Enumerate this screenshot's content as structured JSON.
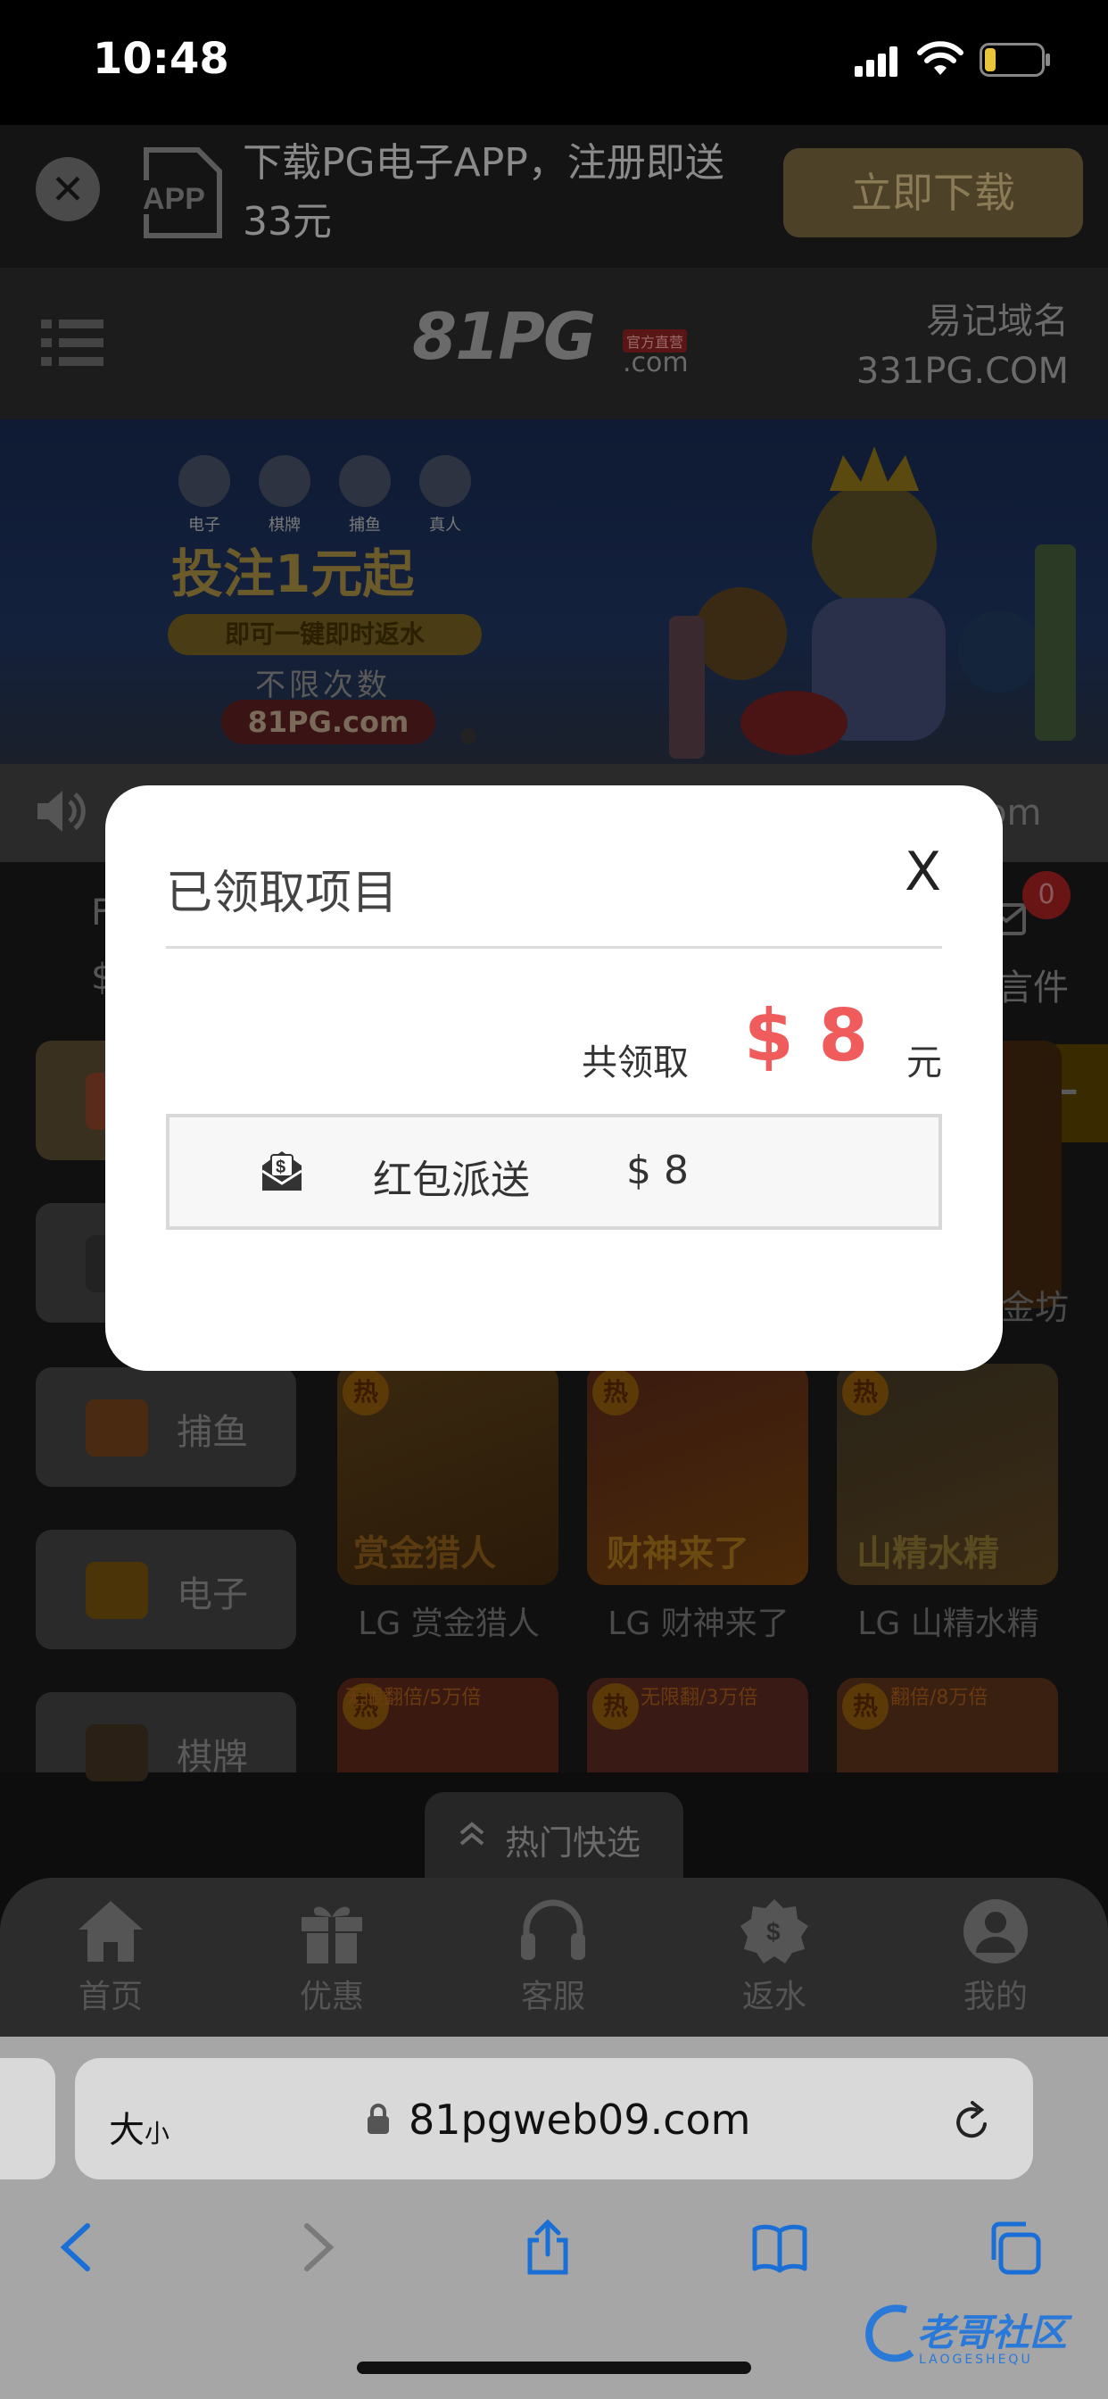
{
  "status_bar": {
    "time": "10:48"
  },
  "download_banner": {
    "close_icon": "x-icon",
    "text": "下载PG电子APP，注册即送33元",
    "button": "立即下载"
  },
  "header": {
    "logo": "81PG",
    "logo_badge": "官方直营",
    "logo_suffix": ".com",
    "domain_tip": [
      "易记域名",
      "331PG.COM"
    ]
  },
  "promo": {
    "categories": [
      "电子",
      "棋牌",
      "捕鱼",
      "真人"
    ],
    "headline": "投注1元起",
    "sub": "即可一键即时返水",
    "sub2": "不限次数",
    "site": "81PG.com"
  },
  "marquee": {
    "text_fragment": "om"
  },
  "account": {
    "fragment_1": "F",
    "fragment_2": "$"
  },
  "mail": {
    "label": "言件",
    "badge": "0"
  },
  "side_tabs": [
    "",
    "",
    "捕鱼",
    "电子",
    "棋牌"
  ],
  "games": [
    {
      "title": "LG 赏金猎人",
      "hot": "热",
      "art": "赏金猎人"
    },
    {
      "title": "LG 财神来了",
      "hot": "热",
      "art": "财神来了"
    },
    {
      "title": "LG 山精水精",
      "hot": "热",
      "art": "山精水精"
    }
  ],
  "games_row2": [
    {
      "hot": "热",
      "banner": "无限翻倍/5万倍"
    },
    {
      "hot": "热",
      "banner": "无限翻/3万倍"
    },
    {
      "hot": "热",
      "banner": "翻倍/8万倍"
    }
  ],
  "partial_game_label": "金坊",
  "quick_pick": "热门快选",
  "bottom_nav": [
    {
      "label": "首页",
      "icon": "home-icon"
    },
    {
      "label": "优惠",
      "icon": "gift-icon"
    },
    {
      "label": "客服",
      "icon": "headset-icon"
    },
    {
      "label": "返水",
      "icon": "rebate-icon"
    },
    {
      "label": "我的",
      "icon": "user-icon"
    }
  ],
  "safari": {
    "text_size_big": "大",
    "text_size_small": "小",
    "url": "81pgweb09.com",
    "toolbar": [
      "back-icon",
      "forward-icon",
      "share-icon",
      "bookmarks-icon",
      "tabs-icon"
    ]
  },
  "watermark": {
    "text": "老哥社区",
    "sub": "LAOGESHEQU"
  },
  "modal": {
    "title": "已领取项目",
    "close": "X",
    "total_label": "共领取",
    "total_amount": "$ 8",
    "total_unit": "元",
    "records": [
      {
        "icon": "red-envelope-icon",
        "name": "红包派送",
        "amount": "$ 8"
      }
    ]
  },
  "colors": {
    "accent_red": "#f05c5c",
    "modal_bg": "#ffffff",
    "ios_blue": "#2a78d8"
  }
}
